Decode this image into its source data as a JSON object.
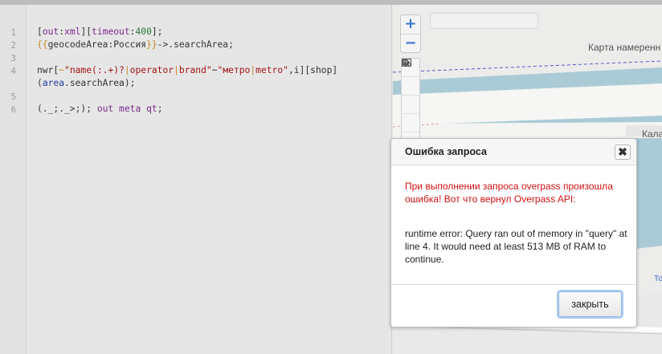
{
  "editor": {
    "line_numbers": [
      "1",
      "2",
      "3",
      "4",
      "5",
      "6"
    ],
    "lines": {
      "l1": {
        "open": "[",
        "kw1": "out",
        "colon1": ":",
        "kw2": "xml",
        "mid": "][",
        "kw3": "timeout",
        "colon2": ":",
        "num": "400",
        "close": "];"
      },
      "l2": {
        "tpl_open": "{{",
        "kw": "geocodeArea",
        "colon": ":",
        "value": "Россия",
        "tpl_close": "}}",
        "rest": "->.searchArea;"
      },
      "l4": {
        "kw": "nwr",
        "open": "[",
        "mod": "~",
        "str1": "\"name(:.+)?",
        "sep1": "|",
        "str2": "operator",
        "sep2": "|",
        "str3": "brand\"",
        "tilde": "~",
        "str4": "\"метро",
        "sep3": "|",
        "str5": "metro\"",
        "rest": ",i][shop]"
      },
      "l4b": {
        "open": "(",
        "var": "area",
        "rest": ".searchArea);"
      },
      "l6": {
        "stmt": "(._;._>;);",
        "kw1": "out",
        "kw2": "meta",
        "kw3": "qt",
        "end": ";"
      }
    }
  },
  "map": {
    "labels": {
      "karta": "Карта намеренн",
      "kala": "Кала",
      "to": "То"
    },
    "zoom_in": "+",
    "zoom_out": "−",
    "colors": {
      "water": "#aacbd6",
      "road": "#ffffff",
      "boundary": "#5a5ac8"
    }
  },
  "dialog": {
    "title": "Ошибка запроса",
    "close_symbol": "✖",
    "error_message": "При выполнении запроса overpass произошла ошибка! Вот что вернул Overpass API:",
    "body": "runtime error: Query ran out of memory in \"query\" at line 4. It would need at least 513 MB of RAM to continue.",
    "button_label": "закрыть"
  }
}
